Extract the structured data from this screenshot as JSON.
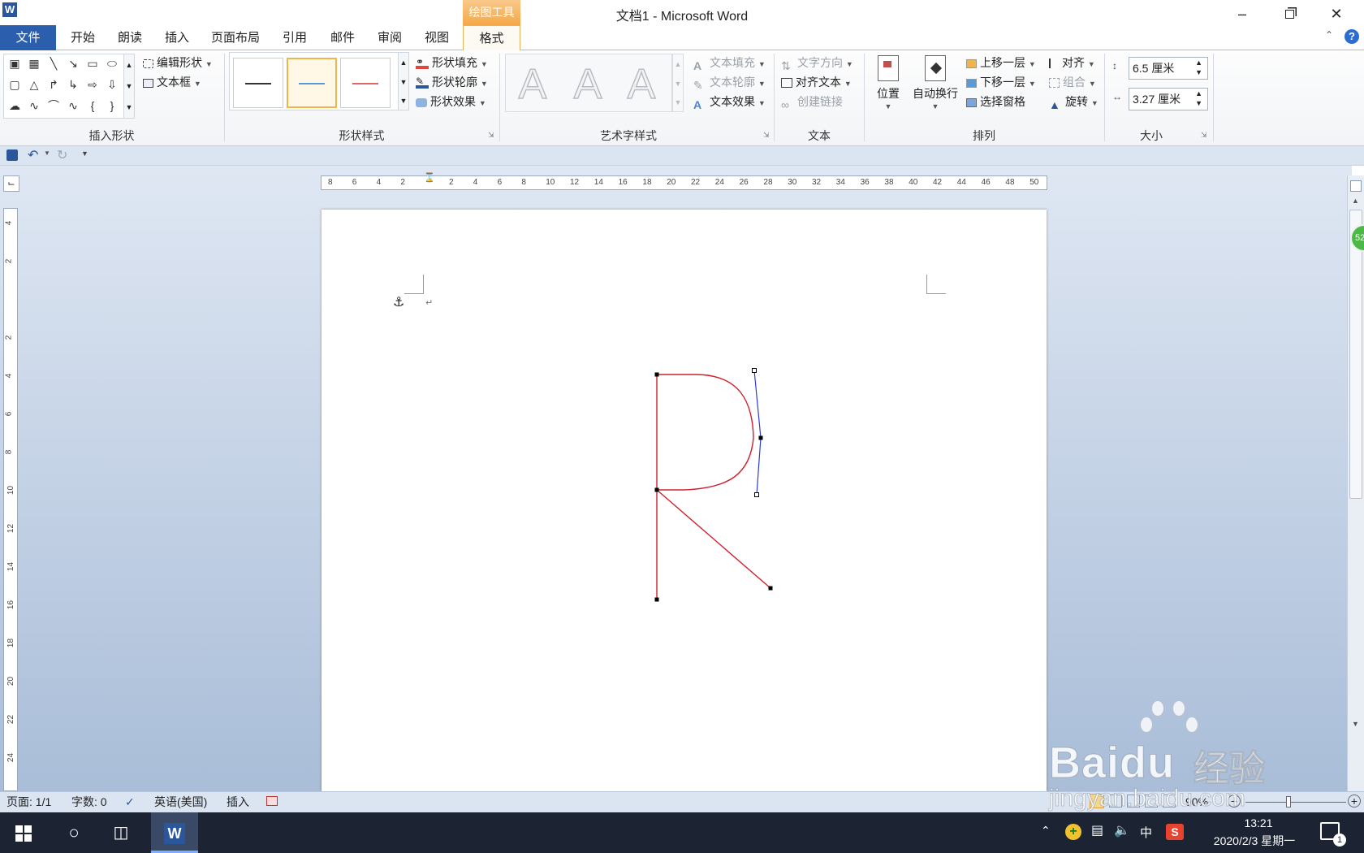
{
  "window": {
    "title": "文档1  -  Microsoft Word",
    "app_icon": "W"
  },
  "context_tab": {
    "header": "绘图工具"
  },
  "tabs": [
    {
      "label": "文件"
    },
    {
      "label": "开始"
    },
    {
      "label": "朗读"
    },
    {
      "label": "插入"
    },
    {
      "label": "页面布局"
    },
    {
      "label": "引用"
    },
    {
      "label": "邮件"
    },
    {
      "label": "审阅"
    },
    {
      "label": "视图"
    },
    {
      "label": "格式"
    }
  ],
  "ribbon": {
    "insert_shapes": {
      "edit_shape": "编辑形状",
      "textbox": "文本框",
      "label": "插入形状"
    },
    "shape_styles": {
      "fill": "形状填充",
      "outline": "形状轮廓",
      "effects": "形状效果",
      "label": "形状样式"
    },
    "wordart_styles": {
      "glyph": "A",
      "fill": "文本填充",
      "outline": "文本轮廓",
      "effects": "文本效果",
      "label": "艺术字样式"
    },
    "text": {
      "direction": "文字方向",
      "align": "对齐文本",
      "link": "创建链接",
      "label": "文本"
    },
    "arrange": {
      "position": "位置",
      "wrap": "自动换行",
      "forward": "上移一层",
      "backward": "下移一层",
      "pane": "选择窗格",
      "align": "对齐",
      "group": "组合",
      "rotate": "旋转",
      "label": "排列"
    },
    "size": {
      "height": "6.5 厘米",
      "width": "3.27 厘米",
      "label": "大小"
    }
  },
  "ruler": {
    "h_ticks": [
      "8",
      "6",
      "4",
      "2",
      "",
      "2",
      "4",
      "6",
      "8",
      "10",
      "12",
      "14",
      "16",
      "18",
      "20",
      "22",
      "24",
      "26",
      "28",
      "30",
      "32",
      "34",
      "36",
      "38",
      "40",
      "42",
      "44",
      "46",
      "48",
      "50"
    ],
    "v_ticks": [
      "4",
      "2",
      "",
      "2",
      "4",
      "6",
      "8",
      "10",
      "12",
      "14",
      "16",
      "18",
      "20",
      "22",
      "24"
    ]
  },
  "document": {
    "paragraph_mark": "↵",
    "anchor": "⚓"
  },
  "status": {
    "page": "页面: 1/1",
    "words": "字数: 0",
    "language": "英语(美国)",
    "mode": "插入",
    "zoom": "90%"
  },
  "taskbar": {
    "time": "13:21",
    "date": "2020/2/3 星期一",
    "ime": "中",
    "notification_count": "1"
  },
  "watermark": {
    "brand": "Baidu",
    "cn": "经验",
    "url": "jingyan.baidu.com"
  },
  "colors": {
    "accent": "#2b579a",
    "context": "#f4a847",
    "path": "#d0202a",
    "handle_line": "#2a3cd6",
    "taskbar": "#1c2333"
  }
}
